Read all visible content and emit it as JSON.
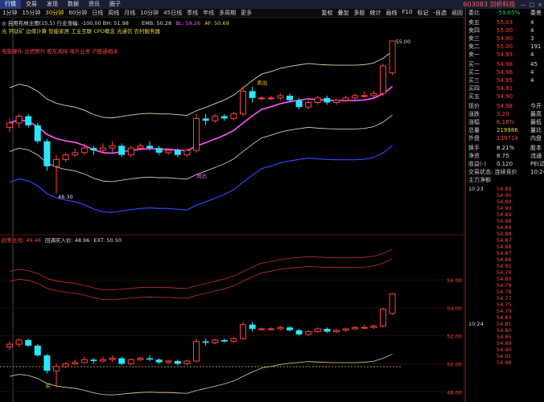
{
  "topbar": {
    "tabs": [
      "行情",
      "交易",
      "发现",
      "数据",
      "资讯",
      "圈子"
    ],
    "active_tab": 0,
    "stock": "603083 剑桥科技",
    "ctrl": [
      "—",
      "□",
      "×"
    ]
  },
  "periodbar": {
    "periods": [
      "1分钟",
      "15分钟",
      "30分钟",
      "60分钟",
      "日线",
      "周线",
      "月线",
      "10分钟",
      "45日线",
      "季线",
      "年线",
      "多周期",
      "更多"
    ],
    "active_period": 2,
    "tools": [
      "复权",
      "叠加",
      "多股",
      "统计",
      "画线",
      "F10",
      "标记",
      "-自选",
      "返回"
    ]
  },
  "main_chart": {
    "header": "◎ 自用布林主图(15,5) 行业涨幅: -100.00 BH: 51.98",
    "emb": "EMB: 50.28",
    "bl": "BL: 59.26",
    "af": "AF: 50.69",
    "concepts": "光 钙钛矿 边缘计算 智能家居 工业互联 CPO概念 光通信 农村服务器",
    "theme": "电脑硬件 业绩预升 股东减持 海外业务 沪股通相关",
    "high_label": "55.00",
    "low_label": "48.30",
    "signal_buy": "卖出",
    "signal_sell": "再出",
    "price_axis": []
  },
  "sub_chart": {
    "header_name": "趋势主线",
    "v1": "49.46",
    "v2_name": "回调买入价",
    "v2": "48.96",
    "v3_name": "EXT",
    "v3": "50.50",
    "price_axis": [
      "56.00",
      "54.00",
      "52.00",
      "50.00",
      "48.00"
    ],
    "signal": "买"
  },
  "quote": {
    "wb_label": "委比",
    "wb_value": "-59.65%",
    "wc_label": "委差",
    "asks": [
      {
        "label": "卖五",
        "price": "55.03",
        "vol": "4"
      },
      {
        "label": "卖四",
        "price": "55.00",
        "vol": "4"
      },
      {
        "label": "卖三",
        "price": "54.90",
        "vol": "3"
      },
      {
        "label": "卖二",
        "price": "55.00",
        "vol": "191"
      },
      {
        "label": "卖一",
        "price": "54.99",
        "vol": "4"
      }
    ],
    "bids": [
      {
        "label": "买一",
        "price": "54.98",
        "vol": "45"
      },
      {
        "label": "买二",
        "price": "54.96",
        "vol": "4"
      },
      {
        "label": "买三",
        "price": "54.95",
        "vol": "4"
      },
      {
        "label": "买四",
        "price": "54.91",
        "vol": ""
      },
      {
        "label": "买五",
        "price": "54.90",
        "vol": ""
      }
    ],
    "stats": [
      {
        "l1": "现价",
        "v1": "54.98",
        "c1": "red",
        "l2": "今开"
      },
      {
        "l1": "涨跌",
        "v1": "3.20",
        "c1": "red",
        "l2": "最高"
      },
      {
        "l1": "涨幅",
        "v1": "6.18%",
        "c1": "red",
        "l2": "最低"
      },
      {
        "l1": "总量",
        "v1": "219986",
        "c1": "yellow",
        "l2": "量比"
      },
      {
        "l1": "外盘",
        "v1": "139714",
        "c1": "red",
        "l2": "内盘"
      }
    ],
    "stats2": [
      {
        "l1": "换手",
        "v1": "8.21%",
        "l2": "股本"
      },
      {
        "l1": "净资",
        "v1": "8.75",
        "l2": "流通"
      },
      {
        "l1": "收益(-)",
        "v1": "0.120",
        "l2": "PE(动)"
      }
    ],
    "trade_status": "交易状态: 连续竞价",
    "trade_time": "10:24",
    "main_flow": "主力净额",
    "ticks": [
      {
        "t": "10:23",
        "p": "54.89",
        "c": "red",
        "v": ""
      },
      {
        "t": "",
        "p": "54.90",
        "c": "red",
        "v": ""
      },
      {
        "t": "",
        "p": "54.89",
        "c": "red",
        "v": ""
      },
      {
        "t": "",
        "p": "54.90",
        "c": "red",
        "v": ""
      },
      {
        "t": "",
        "p": "54.89",
        "c": "red",
        "v": ""
      },
      {
        "t": "",
        "p": "54.88",
        "c": "red",
        "v": ""
      },
      {
        "t": "",
        "p": "54.89",
        "c": "red",
        "v": ""
      },
      {
        "t": "",
        "p": "54.88",
        "c": "red",
        "v": ""
      },
      {
        "t": "",
        "p": "54.87",
        "c": "red",
        "v": ""
      },
      {
        "t": "",
        "p": "54.88",
        "c": "red",
        "v": ""
      },
      {
        "t": "",
        "p": "54.87",
        "c": "red",
        "v": ""
      },
      {
        "t": "",
        "p": "54.86",
        "c": "red",
        "v": ""
      },
      {
        "t": "",
        "p": "54.85",
        "c": "red",
        "v": ""
      },
      {
        "t": "",
        "p": "54.79",
        "c": "red",
        "v": ""
      },
      {
        "t": "",
        "p": "54.80",
        "c": "red",
        "v": ""
      },
      {
        "t": "",
        "p": "54.79",
        "c": "red",
        "v": ""
      },
      {
        "t": "",
        "p": "54.78",
        "c": "red",
        "v": ""
      },
      {
        "t": "",
        "p": "54.77",
        "c": "red",
        "v": ""
      },
      {
        "t": "",
        "p": "54.75",
        "c": "red",
        "v": ""
      },
      {
        "t": "",
        "p": "54.79",
        "c": "red",
        "v": ""
      },
      {
        "t": "",
        "p": "54.83",
        "c": "red",
        "v": ""
      },
      {
        "t": "10:24",
        "p": "54.81",
        "c": "red",
        "v": ""
      },
      {
        "t": "",
        "p": "54.80",
        "c": "red",
        "v": ""
      },
      {
        "t": "",
        "p": "54.85",
        "c": "red",
        "v": ""
      },
      {
        "t": "",
        "p": "54.89",
        "c": "red",
        "v": ""
      },
      {
        "t": "",
        "p": "54.90",
        "c": "red",
        "v": ""
      },
      {
        "t": "",
        "p": "54.91",
        "c": "red",
        "v": ""
      },
      {
        "t": "",
        "p": "54.98",
        "c": "red",
        "v": ""
      }
    ]
  },
  "colors": {
    "up": "#ff4040",
    "down": "#29e6ff",
    "boll_mid": "#ff55ff",
    "boll_up": "#d8d8a0",
    "boll_low": "#c8c8c8",
    "band_low": "#3344ff"
  },
  "candles": [
    {
      "o": 51.2,
      "c": 51.4,
      "h": 51.6,
      "l": 51.0
    },
    {
      "o": 51.4,
      "c": 51.7,
      "h": 51.8,
      "l": 51.2
    },
    {
      "o": 51.7,
      "c": 51.3,
      "h": 51.8,
      "l": 51.2
    },
    {
      "o": 51.3,
      "c": 50.6,
      "h": 51.4,
      "l": 50.5
    },
    {
      "o": 50.6,
      "c": 49.5,
      "h": 50.7,
      "l": 49.3
    },
    {
      "o": 49.5,
      "c": 49.8,
      "h": 50.0,
      "l": 48.3
    },
    {
      "o": 49.8,
      "c": 50.0,
      "h": 50.1,
      "l": 49.7
    },
    {
      "o": 50.0,
      "c": 50.1,
      "h": 50.3,
      "l": 49.9
    },
    {
      "o": 50.1,
      "c": 50.3,
      "h": 50.5,
      "l": 50.0
    },
    {
      "o": 50.3,
      "c": 50.2,
      "h": 50.4,
      "l": 50.0
    },
    {
      "o": 50.2,
      "c": 50.3,
      "h": 50.5,
      "l": 50.1
    },
    {
      "o": 50.3,
      "c": 50.4,
      "h": 50.6,
      "l": 50.1
    },
    {
      "o": 50.4,
      "c": 50.0,
      "h": 50.5,
      "l": 49.9
    },
    {
      "o": 50.0,
      "c": 50.3,
      "h": 50.4,
      "l": 49.9
    },
    {
      "o": 50.3,
      "c": 50.4,
      "h": 50.5,
      "l": 50.2
    },
    {
      "o": 50.4,
      "c": 50.3,
      "h": 50.6,
      "l": 50.2
    },
    {
      "o": 50.3,
      "c": 50.1,
      "h": 50.4,
      "l": 50.0
    },
    {
      "o": 50.1,
      "c": 50.2,
      "h": 50.3,
      "l": 50.0
    },
    {
      "o": 50.2,
      "c": 50.0,
      "h": 50.3,
      "l": 49.9
    },
    {
      "o": 50.0,
      "c": 50.2,
      "h": 50.3,
      "l": 49.9
    },
    {
      "o": 50.2,
      "c": 51.6,
      "h": 51.8,
      "l": 50.1
    },
    {
      "o": 51.6,
      "c": 51.5,
      "h": 51.8,
      "l": 51.3
    },
    {
      "o": 51.5,
      "c": 51.7,
      "h": 51.8,
      "l": 51.4
    },
    {
      "o": 51.7,
      "c": 51.6,
      "h": 51.8,
      "l": 51.5
    },
    {
      "o": 51.6,
      "c": 51.8,
      "h": 51.9,
      "l": 51.5
    },
    {
      "o": 51.8,
      "c": 52.8,
      "h": 53.0,
      "l": 51.7
    },
    {
      "o": 52.8,
      "c": 52.5,
      "h": 53.0,
      "l": 52.3
    },
    {
      "o": 52.5,
      "c": 52.5,
      "h": 52.6,
      "l": 52.4
    },
    {
      "o": 52.5,
      "c": 52.5,
      "h": 52.6,
      "l": 52.4
    },
    {
      "o": 52.5,
      "c": 52.6,
      "h": 52.7,
      "l": 52.4
    },
    {
      "o": 52.6,
      "c": 52.4,
      "h": 52.7,
      "l": 52.3
    },
    {
      "o": 52.4,
      "c": 52.1,
      "h": 52.5,
      "l": 52.0
    },
    {
      "o": 52.1,
      "c": 52.3,
      "h": 52.4,
      "l": 52.0
    },
    {
      "o": 52.3,
      "c": 52.5,
      "h": 52.6,
      "l": 52.2
    },
    {
      "o": 52.5,
      "c": 52.3,
      "h": 52.6,
      "l": 52.2
    },
    {
      "o": 52.3,
      "c": 52.4,
      "h": 52.5,
      "l": 52.2
    },
    {
      "o": 52.4,
      "c": 52.5,
      "h": 52.6,
      "l": 52.3
    },
    {
      "o": 52.5,
      "c": 52.6,
      "h": 52.7,
      "l": 52.4
    },
    {
      "o": 52.6,
      "c": 52.6,
      "h": 52.8,
      "l": 52.5
    },
    {
      "o": 52.6,
      "c": 52.7,
      "h": 52.8,
      "l": 52.5
    },
    {
      "o": 52.7,
      "c": 53.9,
      "h": 54.0,
      "l": 52.6
    },
    {
      "o": 53.6,
      "c": 55.0,
      "h": 55.0,
      "l": 53.5
    }
  ]
}
